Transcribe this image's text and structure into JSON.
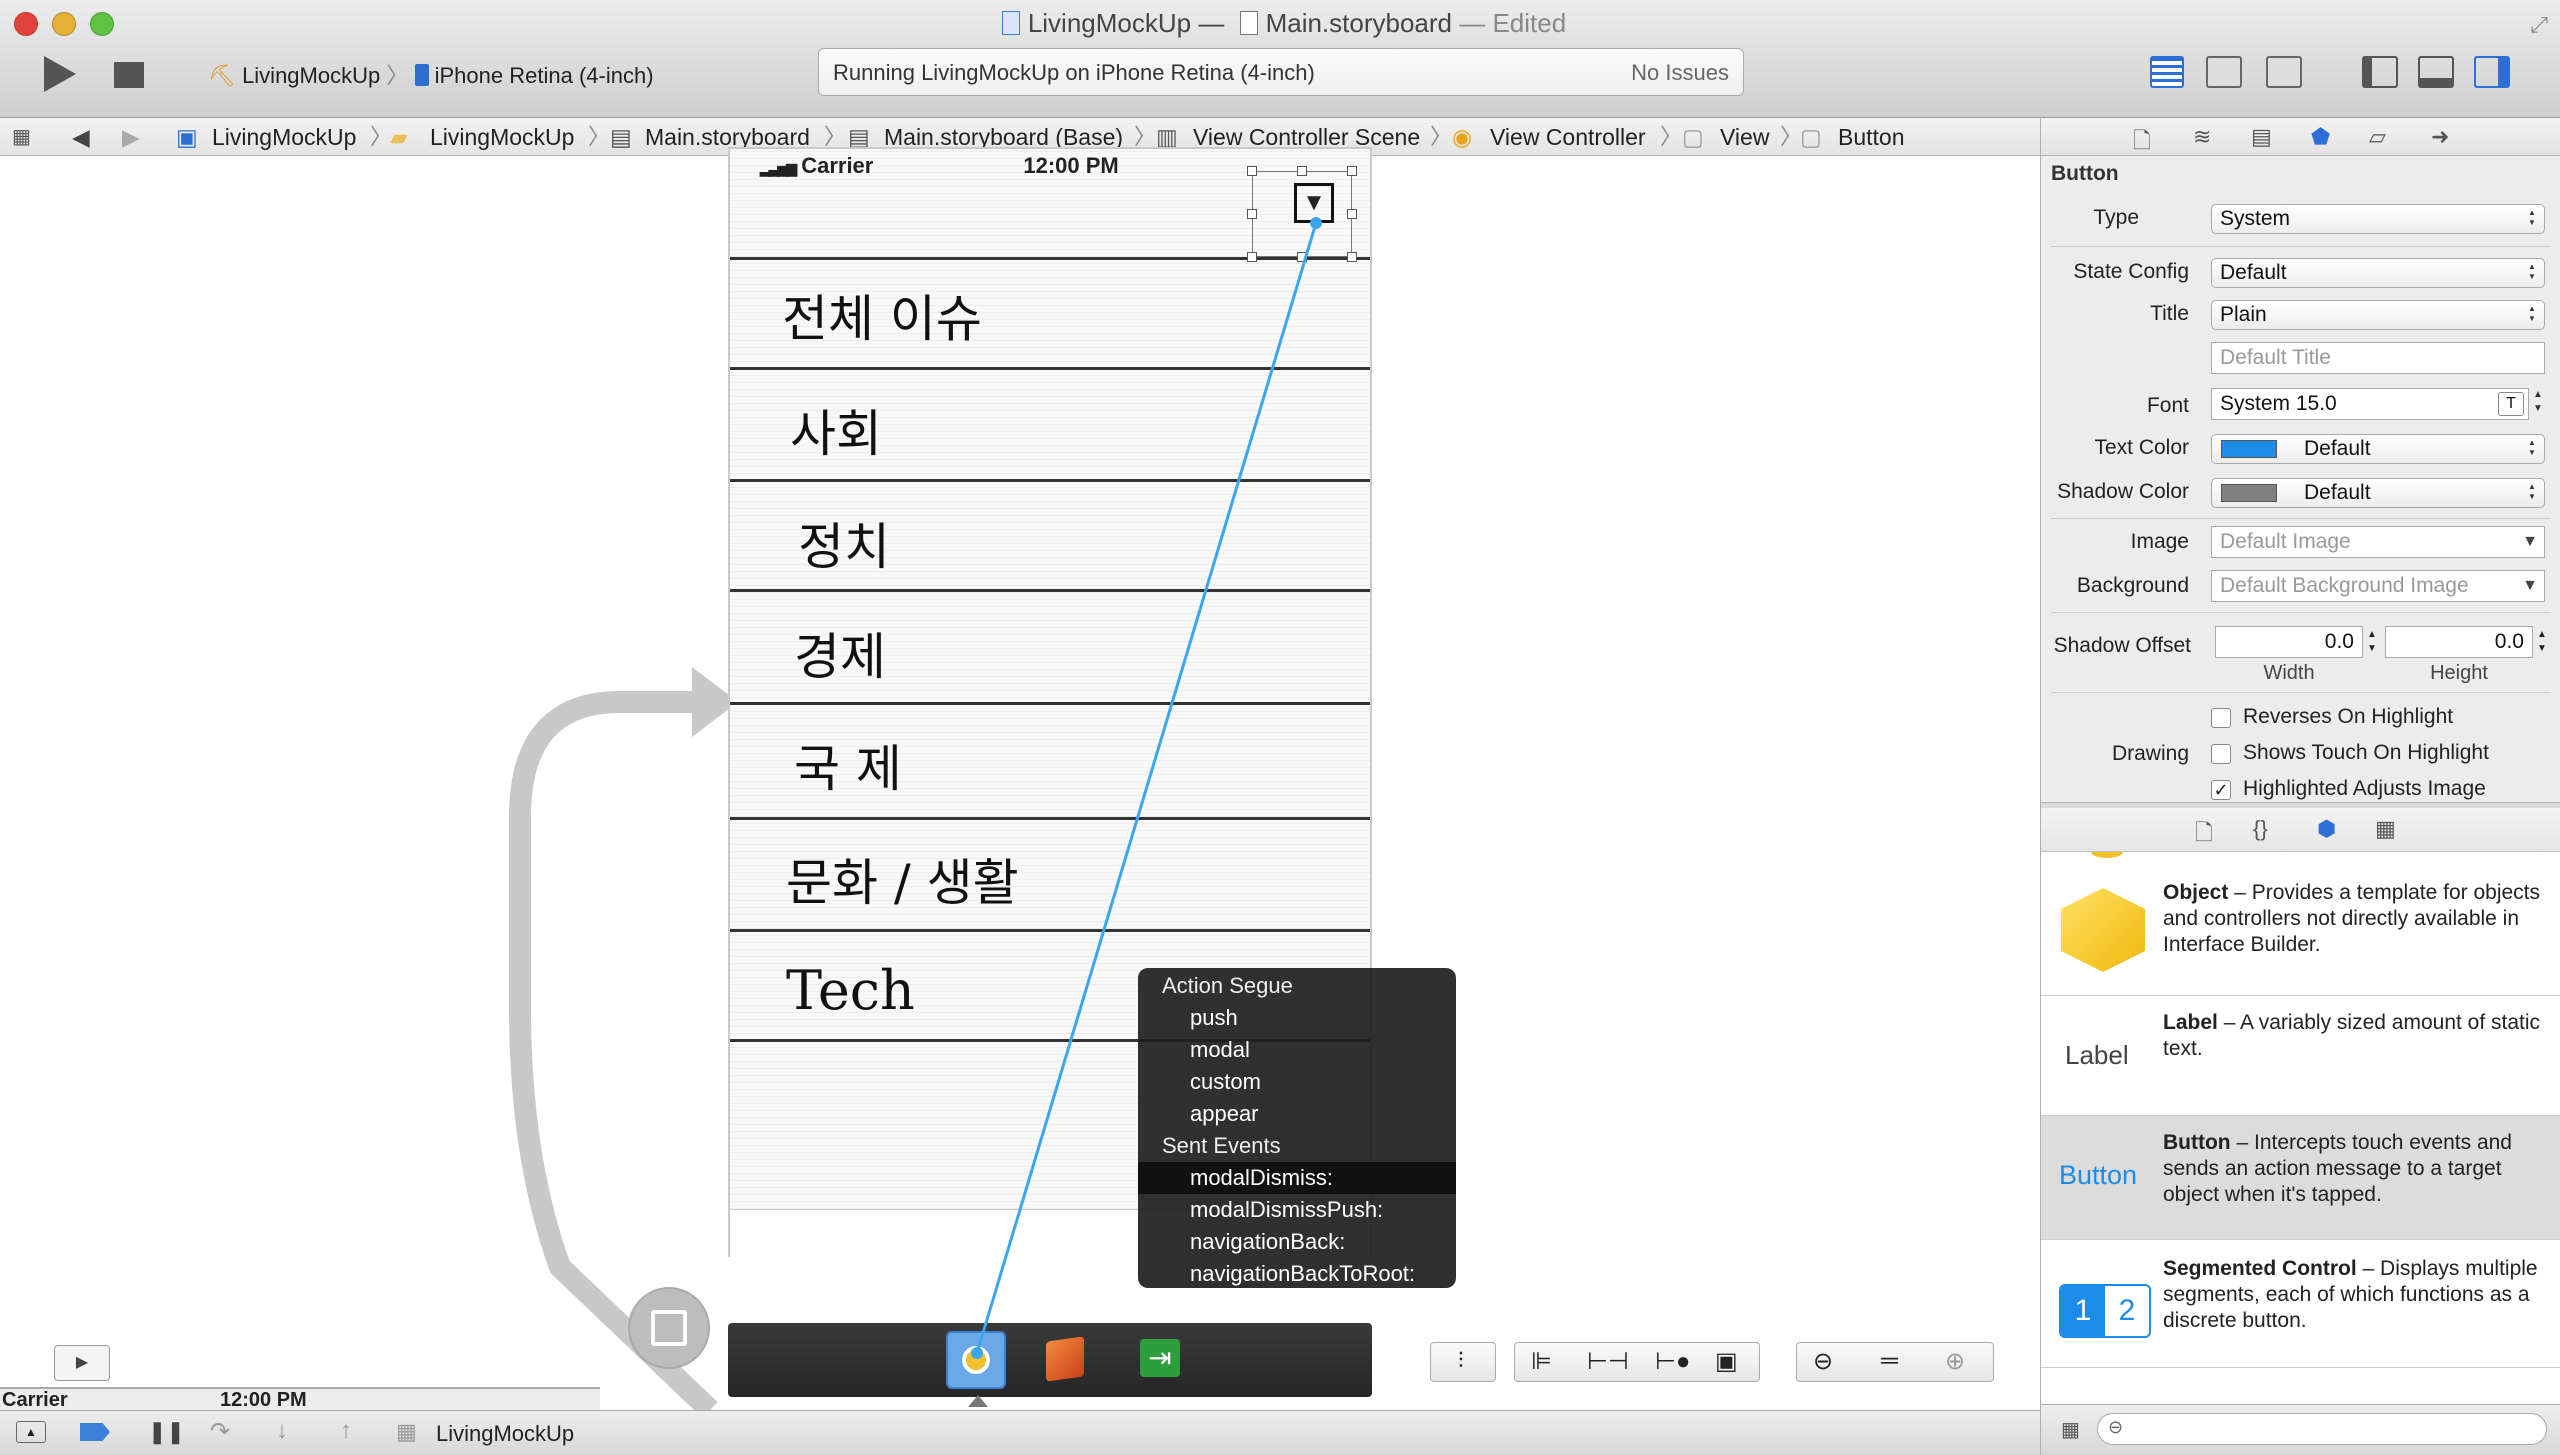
{
  "window": {
    "project": "LivingMockUp",
    "separator": "—",
    "file": "Main.storyboard",
    "state": "— Edited"
  },
  "toolbar": {
    "scheme": "LivingMockUp",
    "device": "iPhone Retina (4-inch)",
    "status_text": "Running LivingMockUp on iPhone Retina (4-inch)",
    "issues": "No Issues"
  },
  "jumpbar": {
    "crumbs": [
      "LivingMockUp",
      "LivingMockUp",
      "Main.storyboard",
      "Main.storyboard (Base)",
      "View Controller Scene",
      "View Controller",
      "View",
      "Button"
    ]
  },
  "phone": {
    "carrier": "Carrier",
    "time": "12:00 PM",
    "rows": [
      "전체 이슈",
      "사회",
      "정치",
      "경제",
      "국 제",
      "문화 / 생활",
      "Tech"
    ]
  },
  "partial_phone": {
    "carrier": "Carrier",
    "time": "12:00 PM"
  },
  "connection_menu": {
    "sections": [
      {
        "header": "Action Segue",
        "items": [
          "push",
          "modal",
          "custom",
          "appear"
        ]
      },
      {
        "header": "Sent Events",
        "items": [
          "modalDismiss:",
          "modalDismissPush:",
          "navigationBack:",
          "navigationBackToRoot:"
        ]
      }
    ],
    "highlighted": "modalDismiss:"
  },
  "inspector": {
    "section": "Button",
    "type_label": "Type",
    "type_value": "System",
    "state_label": "State Config",
    "state_value": "Default",
    "title_label": "Title",
    "title_value": "Plain",
    "title_placeholder": "Default Title",
    "font_label": "Font",
    "font_value": "System 15.0",
    "text_color_label": "Text Color",
    "text_color_value": "Default",
    "text_color_swatch": "#1c8ce8",
    "shadow_color_label": "Shadow Color",
    "shadow_color_value": "Default",
    "shadow_color_swatch": "#808080",
    "image_label": "Image",
    "image_placeholder": "Default Image",
    "background_label": "Background",
    "background_placeholder": "Default Background Image",
    "shadow_offset_label": "Shadow Offset",
    "shadow_width": "0.0",
    "shadow_height": "0.0",
    "width_label": "Width",
    "height_label": "Height",
    "drawing_label": "Drawing",
    "checkboxes": [
      {
        "label": "Reverses On Highlight",
        "checked": false
      },
      {
        "label": "Shows Touch On Highlight",
        "checked": false
      },
      {
        "label": "Highlighted Adjusts Image",
        "checked": true
      }
    ]
  },
  "library": {
    "items": [
      {
        "name": "Object",
        "desc": " – Provides a template for objects and controllers not directly available in Interface Builder.",
        "icon": "cube-icon"
      },
      {
        "name": "Label",
        "desc": " – A variably sized amount of static text.",
        "icon_text": "Label"
      },
      {
        "name": "Button",
        "desc": " – Intercepts touch events and sends an action message to a target object when it's tapped.",
        "icon_text": "Button"
      },
      {
        "name": "Segmented Control",
        "desc": " – Displays multiple segments, each of which functions as a discrete button.",
        "seg1": "1",
        "seg2": "2"
      }
    ]
  },
  "debug": {
    "process": "LivingMockUp"
  },
  "colors": {
    "accent": "#1c8ce8",
    "connection_line": "#3aa6f0",
    "menu_bg": "#2a2a2a"
  }
}
